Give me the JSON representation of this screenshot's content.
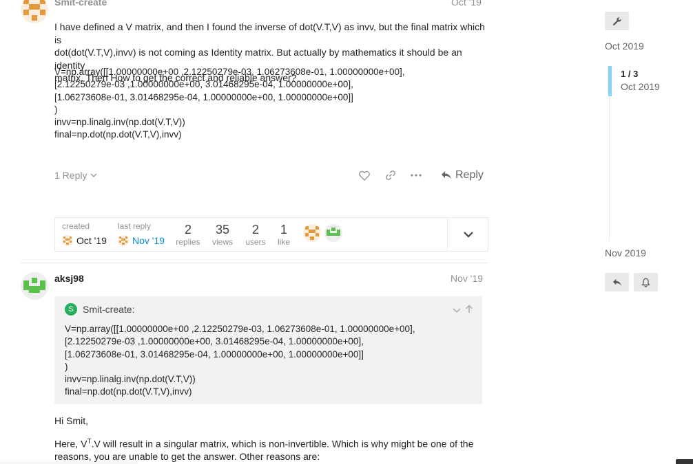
{
  "post1": {
    "author": "Smit-create",
    "date": "Oct '19",
    "body": [
      "I have defined a V matrix, and then I found the inverse of dot(V.T,V) as invv, but the final matrix which is",
      "dot(dot(V.T,V),invv) is not coming as Identity matrix. But actually by mathematics it should be an identity",
      "matrix. Then How to get the correct and reliable answer?"
    ],
    "code": [
      "V=np.array([[1.00000000e+00 ,2.12250279e-03, 1.06273608e-01, 1.00000000e+00],",
      "[2.12250279e-03 ,1.00000000e+00, 3.01468295e-04, 1.00000000e+00],",
      "[1.06273608e-01, 3.01468295e-04, 1.00000000e+00, 1.00000000e+00]]",
      ")",
      "invv=np.linalg.inv(np.dot(V.T,V))",
      "final=np.dot(np.dot(V.T,V),invv)"
    ],
    "replies_toggle": "1 Reply",
    "reply_label": "Reply"
  },
  "topic_map": {
    "created_label": "created",
    "created_date": "Oct '19",
    "last_reply_label": "last reply",
    "last_reply_date": "Nov '19",
    "stats": [
      {
        "num": "2",
        "label": "replies"
      },
      {
        "num": "35",
        "label": "views"
      },
      {
        "num": "2",
        "label": "users"
      },
      {
        "num": "1",
        "label": "like"
      }
    ]
  },
  "post2": {
    "author": "aksj98",
    "date": "Nov '19",
    "quote": {
      "author": "Smit-create:",
      "badge": "S",
      "lines": [
        "V=np.array([[1.00000000e+00 ,2.12250279e-03, 1.06273608e-01, 1.00000000e+00],",
        "[2.12250279e-03 ,1.00000000e+00, 3.01468295e-04, 1.00000000e+00],",
        "[1.06273608e-01, 3.01468295e-04, 1.00000000e+00, 1.00000000e+00]]",
        ")",
        "invv=np.linalg.inv(np.dot(V.T,V))",
        "final=np.dot(np.dot(V.T,V),invv)"
      ]
    },
    "greeting": "Hi Smit,",
    "para_start": "Here, V",
    "para_sup": "T",
    "para_rest": ".V will result in a singular matrix, which is non-invertible. Which is why might be one of the",
    "para_line2": "reasons, you are unable to get the answer. Other reasons are:"
  },
  "timeline": {
    "top_date": "Oct 2019",
    "position": "1 / 3",
    "position_date": "Oct 2019",
    "bottom_date": "Nov 2019"
  },
  "colors": {
    "accent": "#0a8ad6",
    "timeline_bar": "#88d4f5",
    "quote_bg": "#f2f2f2",
    "badge_green": "#27ae60"
  }
}
